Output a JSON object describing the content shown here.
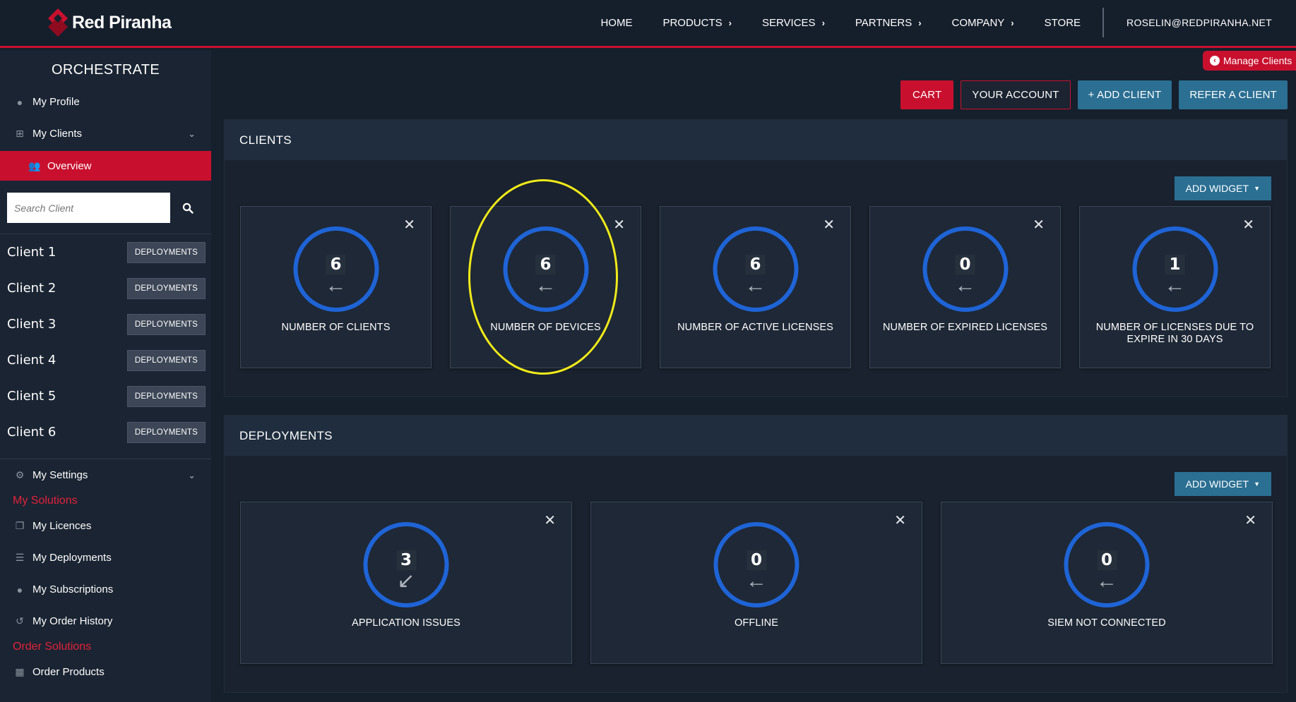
{
  "brand": {
    "name": "Red Piranha"
  },
  "nav": {
    "items": [
      {
        "label": "HOME",
        "has_menu": false
      },
      {
        "label": "PRODUCTS",
        "has_menu": true
      },
      {
        "label": "SERVICES",
        "has_menu": true
      },
      {
        "label": "PARTNERS",
        "has_menu": true
      },
      {
        "label": "COMPANY",
        "has_menu": true
      },
      {
        "label": "STORE",
        "has_menu": false
      }
    ],
    "user_email": "ROSELIN@REDPIRANHA.NET"
  },
  "manage_clients_label": "Manage Clients",
  "sidebar": {
    "title": "ORCHESTRATE",
    "my_profile": "My Profile",
    "my_clients": "My Clients",
    "overview": "Overview",
    "search_placeholder": "Search Client",
    "clients": [
      {
        "name": "Client 1",
        "action": "DEPLOYMENTS"
      },
      {
        "name": "Client 2",
        "action": "DEPLOYMENTS"
      },
      {
        "name": "Client 3",
        "action": "DEPLOYMENTS"
      },
      {
        "name": "Client 4",
        "action": "DEPLOYMENTS"
      },
      {
        "name": "Client 5",
        "action": "DEPLOYMENTS"
      },
      {
        "name": "Client 6",
        "action": "DEPLOYMENTS"
      }
    ],
    "my_settings": "My Settings",
    "my_solutions_heading": "My Solutions",
    "my_licences": "My Licences",
    "my_deployments": "My Deployments",
    "my_subscriptions": "My Subscriptions",
    "my_order_history": "My Order History",
    "order_solutions_heading": "Order Solutions",
    "order_products": "Order Products"
  },
  "actions": {
    "cart": "CART",
    "your_account": "YOUR ACCOUNT",
    "add_client": "+ ADD CLIENT",
    "refer_client": "REFER A CLIENT"
  },
  "clients_panel": {
    "title": "CLIENTS",
    "add_widget": "ADD WIDGET",
    "widgets": [
      {
        "value": "6",
        "label": "NUMBER OF CLIENTS",
        "trend": "left-arrow"
      },
      {
        "value": "6",
        "label": "NUMBER OF DEVICES",
        "trend": "left-arrow"
      },
      {
        "value": "6",
        "label": "NUMBER OF ACTIVE LICENSES",
        "trend": "left-arrow"
      },
      {
        "value": "0",
        "label": "NUMBER OF EXPIRED LICENSES",
        "trend": "left-arrow"
      },
      {
        "value": "1",
        "label": "NUMBER OF LICENSES DUE TO EXPIRE IN 30 DAYS",
        "trend": "left-arrow"
      }
    ]
  },
  "deployments_panel": {
    "title": "DEPLOYMENTS",
    "add_widget": "ADD WIDGET",
    "widgets": [
      {
        "value": "3",
        "label": "APPLICATION ISSUES",
        "trend": "down-left-arrow"
      },
      {
        "value": "0",
        "label": "OFFLINE",
        "trend": "left-arrow"
      },
      {
        "value": "0",
        "label": "SIEM NOT CONNECTED",
        "trend": "left-arrow"
      }
    ]
  },
  "colors": {
    "accent_red": "#c8102e",
    "action_blue": "#2b6f93",
    "ring_blue": "#1f64d6",
    "highlight_yellow": "#f0ea1a"
  }
}
